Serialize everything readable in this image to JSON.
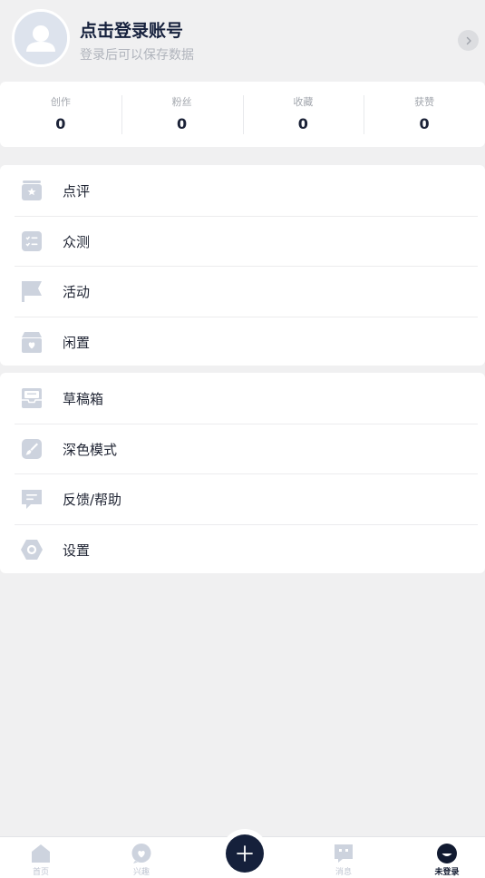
{
  "header": {
    "title": "点击登录账号",
    "subtitle": "登录后可以保存数据"
  },
  "stats": [
    {
      "label": "创作",
      "value": "0"
    },
    {
      "label": "粉丝",
      "value": "0"
    },
    {
      "label": "收藏",
      "value": "0"
    },
    {
      "label": "获赞",
      "value": "0"
    }
  ],
  "menu_group_1": [
    {
      "label": "点评",
      "icon": "review-box-star-icon"
    },
    {
      "label": "众测",
      "icon": "checklist-icon"
    },
    {
      "label": "活动",
      "icon": "flag-icon"
    },
    {
      "label": "闲置",
      "icon": "idle-box-heart-icon"
    }
  ],
  "menu_group_2": [
    {
      "label": "草稿箱",
      "icon": "inbox-icon"
    },
    {
      "label": "深色模式",
      "icon": "brush-icon"
    },
    {
      "label": "反馈/帮助",
      "icon": "feedback-icon"
    },
    {
      "label": "设置",
      "icon": "hexagon-settings-icon"
    }
  ],
  "tabbar": {
    "tabs": [
      {
        "label": "首页",
        "icon": "home-icon",
        "active": false
      },
      {
        "label": "兴趣",
        "icon": "heart-bubble-icon",
        "active": false
      },
      {
        "label": "消息",
        "icon": "message-icon",
        "active": false
      },
      {
        "label": "未登录",
        "icon": "profile-face-icon",
        "active": true
      }
    ],
    "center_button_icon": "plus-icon"
  },
  "colors": {
    "background": "#f0f0f1",
    "primary_text": "#16213d",
    "muted_text": "#b0b4bc",
    "icon_gray": "#cdd3de",
    "accent_dark": "#15203b"
  }
}
